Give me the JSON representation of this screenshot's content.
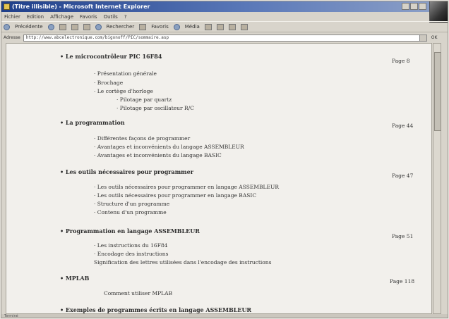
{
  "window": {
    "title": "(Titre illisible) - Microsoft Internet Explorer"
  },
  "menu": [
    "Fichier",
    "Edition",
    "Affichage",
    "Favoris",
    "Outils",
    "?"
  ],
  "toolbar": {
    "back_label": "Précédente",
    "search_label": "Rechercher",
    "favorites_label": "Favoris",
    "media_label": "Média"
  },
  "address": {
    "label": "Adresse",
    "url": "http://www.abcelectronique.com/bigonoff/PIC/sommaire.asp",
    "go_label": "OK"
  },
  "status": {
    "text": "Terminé"
  },
  "sections": [
    {
      "title": "Le microcontrôleur PIC 16F84",
      "page": "Page 8",
      "items": [
        {
          "text": "Présentation générale",
          "level": 1
        },
        {
          "text": "Brochage",
          "level": 1
        },
        {
          "text": "Le cortège d'horloge",
          "level": 1
        },
        {
          "text": "Pilotage par quartz",
          "level": 2
        },
        {
          "text": "Pilotage par oscillateur R/C",
          "level": 2
        }
      ]
    },
    {
      "title": "La programmation",
      "page": "Page 44",
      "items": [
        {
          "text": "Différentes façons de programmer",
          "level": 1
        },
        {
          "text": "Avantages et inconvénients du langage ASSEMBLEUR",
          "level": 1
        },
        {
          "text": "Avantages et inconvénients du langage BASIC",
          "level": 1
        }
      ]
    },
    {
      "title": "Les outils nécessaires pour programmer",
      "page": "Page 47",
      "items": [
        {
          "text": "Les outils nécessaires pour programmer en langage ASSEMBLEUR",
          "level": 1
        },
        {
          "text": "Les outils nécessaires pour programmer en langage BASIC",
          "level": 1
        },
        {
          "text": "Structure d'un programme",
          "level": 1
        },
        {
          "text": "Contenu d'un programme",
          "level": 1
        }
      ]
    },
    {
      "title": "Programmation en langage ASSEMBLEUR",
      "page": "Page 51",
      "items": [
        {
          "text": "Les instructions du 16F84",
          "level": 1
        },
        {
          "text": "Encodage des instructions",
          "level": 1
        },
        {
          "text": "Signification des lettres utilisées dans l'encodage des instructions",
          "level": 1
        }
      ]
    },
    {
      "title": "MPLAB",
      "page": "Page 118",
      "items": [
        {
          "text": "Comment utiliser MPLAB",
          "level": 1
        }
      ]
    },
    {
      "title": "Exemples de programmes écrits en langage ASSEMBLEUR",
      "page": "",
      "items": []
    }
  ]
}
